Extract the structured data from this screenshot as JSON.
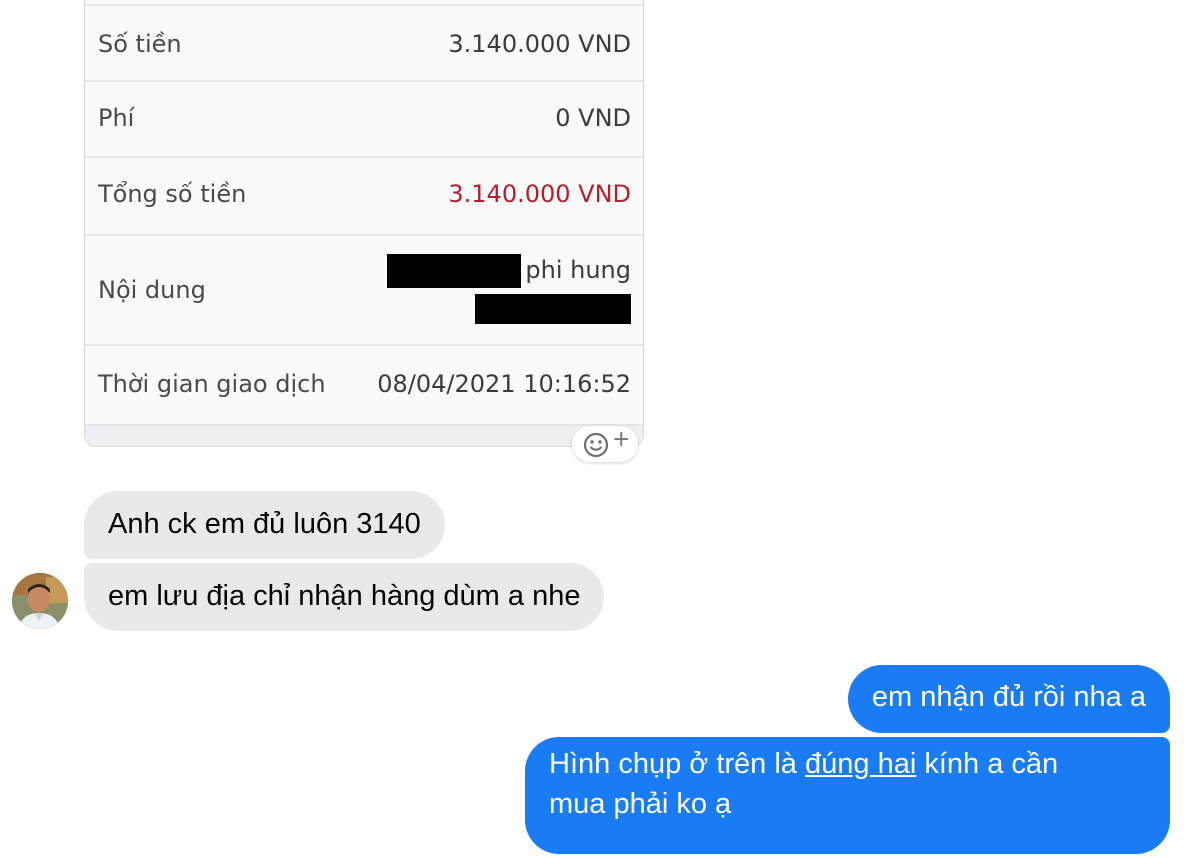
{
  "receipt": {
    "rows": [
      {
        "label": "Số tiền",
        "value": "3.140.000 VND"
      },
      {
        "label": "Phí",
        "value": "0 VND"
      },
      {
        "label": "Tổng số tiền",
        "value": "3.140.000 VND"
      },
      {
        "label": "Nội dung",
        "value": "phi hung"
      },
      {
        "label": "Thời gian giao dịch",
        "value": "08/04/2021 10:16:52"
      }
    ],
    "total_color": "#b3202b"
  },
  "reaction_button": {
    "icon": "add-reaction-icon",
    "plus": "+"
  },
  "messages": {
    "incoming": [
      "Anh ck em đủ luôn 3140",
      "em lưu địa chỉ nhận hàng dùm a nhe"
    ],
    "outgoing": [
      "em nhận đủ rồi nha a",
      {
        "part1": "Hình chụp ở trên là ",
        "underlined": "đúng hai",
        "part2": " kính a cần",
        "line2": "mua phải ko ạ"
      }
    ]
  },
  "colors": {
    "incoming_bubble": "#e9e9eb",
    "outgoing_bubble": "#1a7cf5"
  }
}
